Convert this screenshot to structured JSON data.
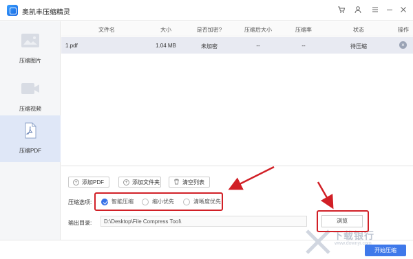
{
  "app": {
    "title": "奥凯丰压缩精灵"
  },
  "titlebar": {
    "icons": [
      "cart-icon",
      "user-icon",
      "menu-icon",
      "minimize-icon",
      "close-icon"
    ]
  },
  "sidebar": {
    "items": [
      {
        "label": "压缩图片",
        "icon": "image-icon"
      },
      {
        "label": "压缩视频",
        "icon": "video-icon"
      },
      {
        "label": "压缩PDF",
        "icon": "pdf-icon",
        "active": true
      }
    ]
  },
  "table": {
    "columns": [
      "文件名",
      "大小",
      "是否加密?",
      "压缩后大小",
      "压缩率",
      "状态",
      "操作"
    ],
    "rows": [
      {
        "name": "1.pdf",
        "size": "1.04 MB",
        "encrypted": "未加密",
        "compressed_size": "--",
        "ratio": "--",
        "status": "待压缩"
      }
    ]
  },
  "buttons": {
    "add_pdf": "添加PDF",
    "add_folder": "添加文件夹",
    "clear_list": "清空列表"
  },
  "options": {
    "label": "压缩选项:",
    "choices": [
      {
        "label": "智能压缩",
        "selected": true
      },
      {
        "label": "缩小优先",
        "selected": false
      },
      {
        "label": "清晰度优先",
        "selected": false
      }
    ]
  },
  "output": {
    "label": "输出目录:",
    "path": "D:\\Desktop\\File Compress Tool\\",
    "browse": "浏览"
  },
  "start_button": "开始压缩",
  "watermark": {
    "text": "下载银行",
    "sub": "www.downyi.com"
  },
  "colors": {
    "accent": "#3f79ea",
    "annotation": "#d11f26",
    "sidebar_active": "#dfe7f7"
  }
}
